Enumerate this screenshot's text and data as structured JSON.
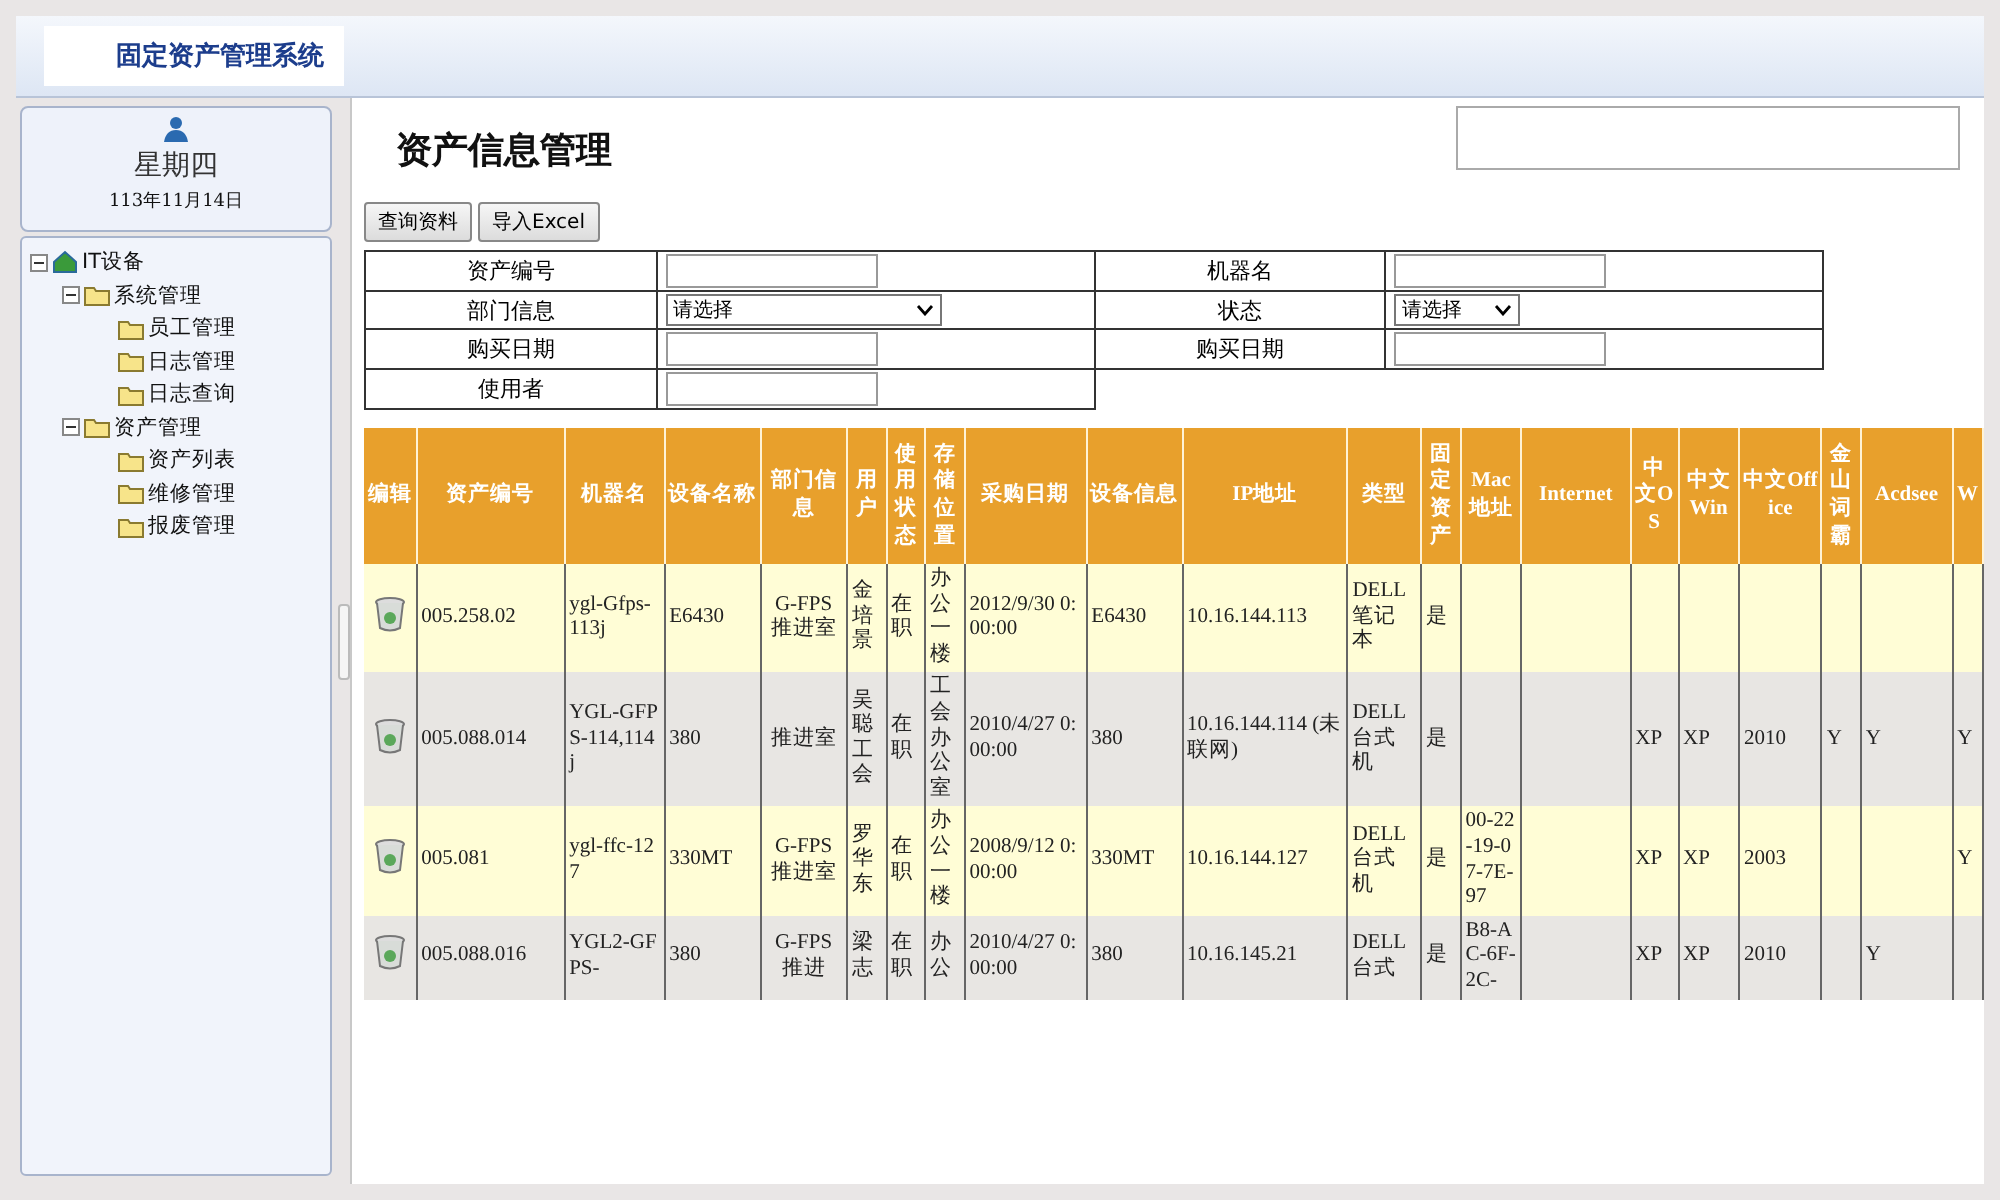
{
  "header": {
    "title": "固定资产管理系统"
  },
  "date_card": {
    "weekday": "星期四",
    "date": "113年11月14日"
  },
  "tree": [
    {
      "label": "IT设备",
      "kind": "home",
      "expanded": true,
      "children": [
        {
          "label": "系统管理",
          "kind": "folder",
          "expanded": true,
          "children": [
            {
              "label": "员工管理",
              "kind": "folder"
            },
            {
              "label": "日志管理",
              "kind": "folder"
            },
            {
              "label": "日志查询",
              "kind": "folder"
            }
          ]
        },
        {
          "label": "资产管理",
          "kind": "folder",
          "expanded": true,
          "children": [
            {
              "label": "资产列表",
              "kind": "folder"
            },
            {
              "label": "维修管理",
              "kind": "folder"
            },
            {
              "label": "报废管理",
              "kind": "folder"
            }
          ]
        }
      ]
    }
  ],
  "page_title": "资产信息管理",
  "buttons": [
    "查询资料",
    "导入Excel"
  ],
  "form": {
    "rows": [
      [
        {
          "label": "资产编号",
          "kind": "text"
        },
        {
          "label": "机器名",
          "kind": "text"
        }
      ],
      [
        {
          "label": "部门信息",
          "kind": "select",
          "value": "请选择"
        },
        {
          "label": "状态",
          "kind": "select",
          "value": "请选择"
        }
      ],
      [
        {
          "label": "购买日期",
          "kind": "text"
        },
        {
          "label": "购买日期",
          "kind": "text"
        }
      ],
      [
        {
          "label": "使用者",
          "kind": "text"
        }
      ]
    ]
  },
  "table": {
    "columns": [
      "编辑",
      "资产编号",
      "机器名",
      "设备名称",
      "部门信息",
      "用户",
      "使用状态",
      "存储位置",
      "采购日期",
      "设备信息",
      "IP地址",
      "类型",
      "固定资产",
      "Mac地址",
      "Internet",
      "中文OS",
      "中文Win",
      "中文Office",
      "金山词霸",
      "Acdsee",
      "W"
    ],
    "rows": [
      {
        "cells": [
          "",
          "005.258.02",
          "ygl-Gfps-113j",
          "E6430",
          "G-FPS推进室",
          "金培景",
          "在职",
          "办公一楼",
          "2012/9/30 0:00:00",
          "E6430",
          "10.16.144.113",
          "DELL笔记本",
          "是",
          "",
          "",
          "",
          "",
          "",
          "",
          "",
          ""
        ]
      },
      {
        "cells": [
          "",
          "005.088.014",
          "YGL-GFPS-114,114j",
          "380",
          "推进室",
          "吴聪工会",
          "在职",
          "工会办公室",
          "2010/4/27 0:00:00",
          "380",
          "10.16.144.114 (未联网)",
          "DELL台式机",
          "是",
          "",
          "",
          "XP",
          "XP",
          "2010",
          "Y",
          "Y",
          "Y"
        ]
      },
      {
        "cells": [
          "",
          "005.081",
          "ygl-ffc-127",
          "330MT",
          "G-FPS推进室",
          "罗华东",
          "在职",
          "办公一楼",
          "2008/9/12 0:00:00",
          "330MT",
          "10.16.144.127",
          "DELL台式机",
          "是",
          "00-22-19-07-7E-97",
          "",
          "XP",
          "XP",
          "2003",
          "",
          "",
          "Y"
        ]
      },
      {
        "cells": [
          "",
          "005.088.016",
          "YGL2-GFPS-",
          "380",
          "G-FPS推进",
          "梁志",
          "在职",
          "办公",
          "2010/4/27 0:00:00",
          "380",
          "10.16.145.21",
          "DELL台式",
          "是",
          "B8-AC-6F-2C-",
          "",
          "XP",
          "XP",
          "2010",
          "",
          "Y",
          ""
        ]
      }
    ]
  }
}
